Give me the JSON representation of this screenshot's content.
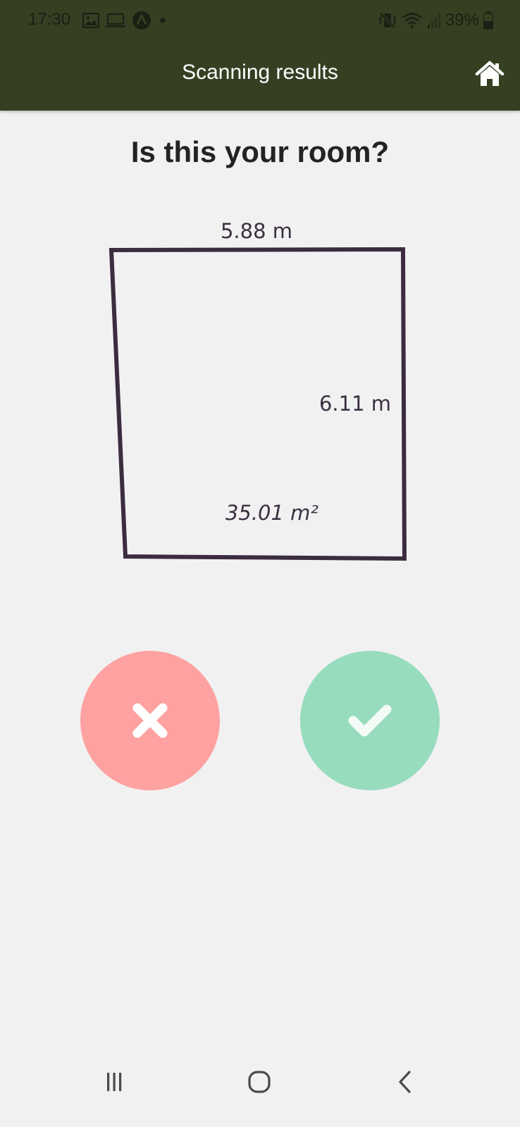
{
  "status_bar": {
    "time": "17:30",
    "battery": "39%",
    "left_icons": [
      "image-icon",
      "laptop-icon",
      "navigation-icon",
      "dot-icon"
    ],
    "right_icons": [
      "vibrate-icon",
      "wifi-icon",
      "signal-icon",
      "battery-icon"
    ]
  },
  "app_bar": {
    "title": "Scanning results",
    "home_icon": "home-icon",
    "background": "#354023"
  },
  "main": {
    "question": "Is this your room?",
    "room": {
      "width_label": "5.88 m",
      "depth_label": "6.11 m",
      "area_label": "35.01 m²",
      "outline_color": "#3b2c40"
    },
    "actions": {
      "reject": {
        "icon": "close-icon",
        "color": "#fea1a1"
      },
      "accept": {
        "icon": "check-icon",
        "color": "#97dcbd"
      }
    }
  },
  "nav_bar": {
    "recents_icon": "recents-icon",
    "home_icon": "home-circle-icon",
    "back_icon": "back-icon"
  }
}
